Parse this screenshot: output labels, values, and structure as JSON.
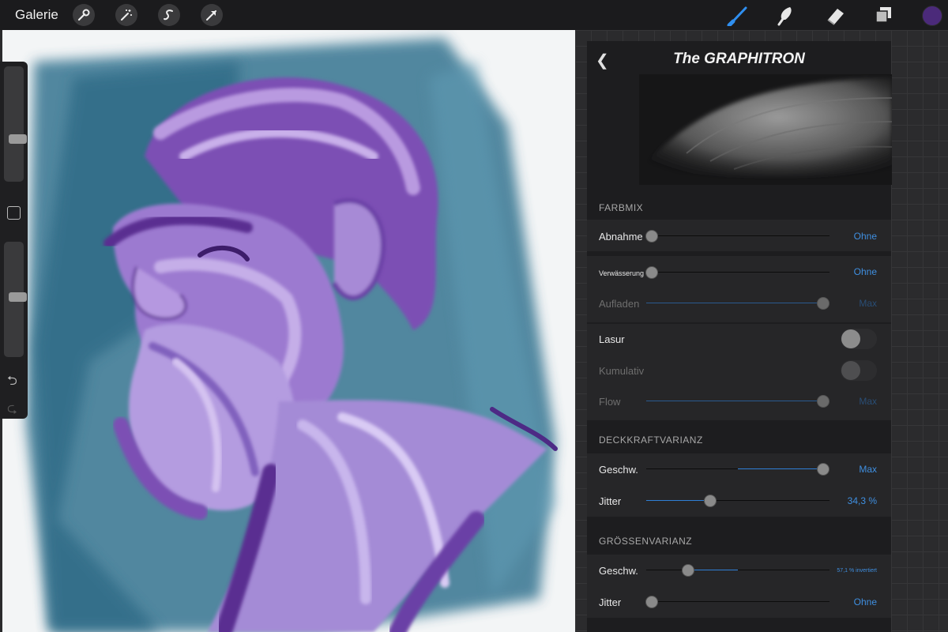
{
  "topbar": {
    "gallery_label": "Galerie",
    "left_tools": [
      "wrench-icon",
      "magic-wand-icon",
      "selection-s-icon",
      "transform-arrow-icon"
    ],
    "right_tools": [
      "brush-icon",
      "smudge-icon",
      "eraser-icon",
      "layers-icon"
    ],
    "active_tool": "brush-icon",
    "current_color": "#4b2a7a"
  },
  "sidebar": {
    "brush_size_level": 0.62,
    "opacity_level": 0.48,
    "undo_icon": "undo-icon",
    "redo_icon": "redo-icon"
  },
  "panel": {
    "brush_name": "The GRAPHITRON",
    "sections": {
      "farbmix": "FARBMIX",
      "deckkraft": "DECKKRAFTVARIANZ",
      "groessen": "GRÖSSENVARIANZ"
    },
    "rows": {
      "abnahme": {
        "label": "Abnahme",
        "value": "Ohne",
        "level": 0
      },
      "verwaesserung": {
        "label": "Verwässerung",
        "value": "Ohne",
        "level": 0
      },
      "aufladen": {
        "label": "Aufladen",
        "value": "Max",
        "level": 1
      },
      "lasur": {
        "label": "Lasur",
        "state": "off"
      },
      "kumulativ": {
        "label": "Kumulativ",
        "state": "off"
      },
      "flow": {
        "label": "Flow",
        "value": "Max",
        "level": 1
      },
      "dk_geschw": {
        "label": "Geschw.",
        "value": "Max",
        "level": 1
      },
      "dk_jitter": {
        "label": "Jitter",
        "value": "34,3 %",
        "level": 0.343
      },
      "gr_geschw": {
        "label": "Geschw.",
        "value": "57,1 % invertiert",
        "level": 0.571
      },
      "gr_jitter": {
        "label": "Jitter",
        "value": "Ohne",
        "level": 0
      }
    }
  },
  "colors": {
    "accent": "#3f8fe0",
    "panel_bg": "#1d1d1f",
    "topbar_bg": "#1b1b1d"
  }
}
